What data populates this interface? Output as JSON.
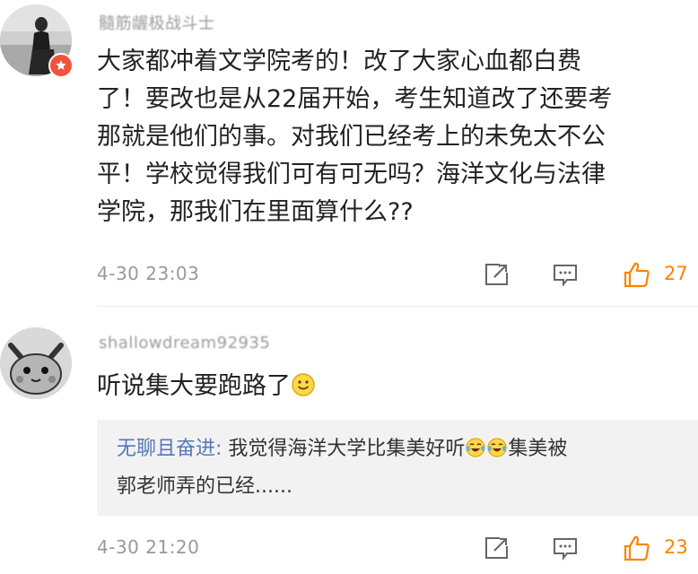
{
  "comments": [
    {
      "username": "髓筋龌极战斗士",
      "content_lines": [
        "大家都冲着文学院考的！改了大家心血都白费",
        "了！要改也是从22届开始，考生知道改了还要考",
        "那就是他们的事。对我们已经考上的未免太不公",
        "平！学校觉得我们可有可无吗？海洋文化与法律",
        "学院，那我们在里面算什么??"
      ],
      "timestamp": "4-30 23:03",
      "likes": "27"
    },
    {
      "username": "shallowdream92935",
      "content": "听说集大要跑路了",
      "reply": {
        "author": "无聊且奋进:",
        "text_part1": " 我觉得海洋大学比集美好听",
        "text_part2": "集美被",
        "text_line2": "郭老师弄的已经......"
      },
      "timestamp": "4-30 21:20",
      "likes": "23"
    }
  ],
  "colors": {
    "accent": "#ff8200",
    "reply_name": "#5479b8",
    "badge": "#f0523e"
  },
  "icons": {
    "share": "share-icon",
    "comment": "comment-icon",
    "like": "thumbs-up-icon",
    "badge": "star-badge-icon",
    "smile": "smile-emoji-icon",
    "laugh_cry": "laugh-cry-emoji-icon"
  }
}
